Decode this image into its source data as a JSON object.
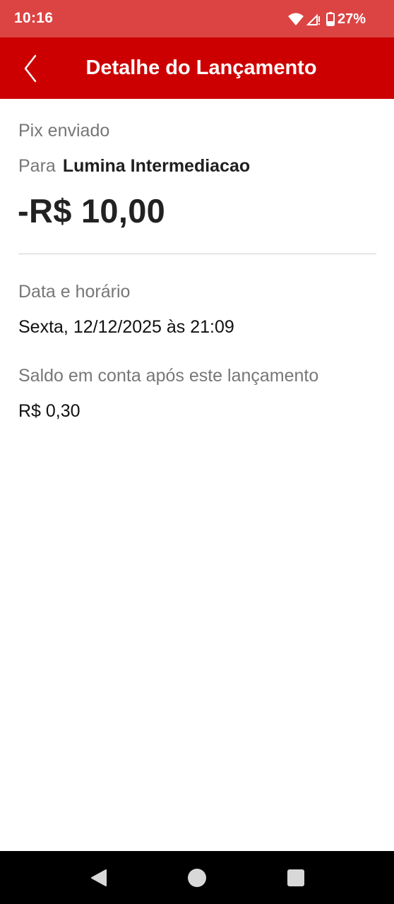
{
  "status_bar": {
    "time": "10:16",
    "battery_percent": "27%",
    "icons": [
      "wifi-icon",
      "cellular-no-signal-icon",
      "battery-icon"
    ],
    "background_color": "#dc4444"
  },
  "app_bar": {
    "title": "Detalhe do Lançamento",
    "back_icon": "chevron-left-icon",
    "background_color": "#cc0000"
  },
  "transaction": {
    "type": "Pix enviado",
    "recipient_prefix": "Para",
    "recipient_name": "Lumina Intermediacao",
    "amount": "-R$ 10,00",
    "date_label": "Data e horário",
    "date_value": "Sexta, 12/12/2025 às 21:09",
    "balance_label": "Saldo em conta após este lançamento",
    "balance_value": "R$ 0,30"
  },
  "nav_bar": {
    "buttons": [
      "nav-back-icon",
      "nav-home-icon",
      "nav-recents-icon"
    ]
  }
}
